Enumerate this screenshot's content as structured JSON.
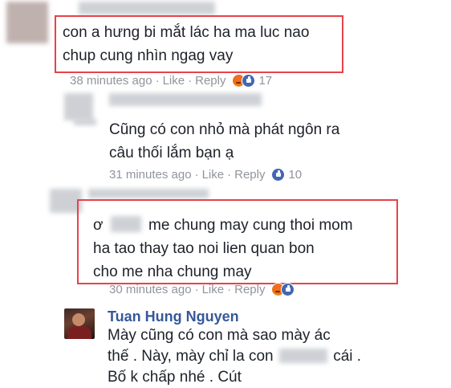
{
  "comments": [
    {
      "lines": [
        "con a hưng bi mắt lác ha ma luc nao",
        "chup cung nhìn ngag vay"
      ],
      "time": "38 minutes ago",
      "like_label": "Like",
      "reply_label": "Reply",
      "reactions": [
        "angry-icon",
        "like-icon"
      ],
      "reaction_count": "17"
    },
    {
      "lines": [
        "Cũng có con nhỏ mà phát ngôn ra",
        "câu thối lắm bạn ạ"
      ],
      "time": "31 minutes ago",
      "like_label": "Like",
      "reply_label": "Reply",
      "reactions": [
        "like-icon"
      ],
      "reaction_count": "10"
    },
    {
      "lines": [
        "ơ",
        "me chung may cung thoi mom",
        "ha tao thay tao noi lien quan bon",
        "cho me nha chung may"
      ],
      "time": "30 minutes ago",
      "like_label": "Like",
      "reply_label": "Reply",
      "reactions": [
        "angry-icon",
        "like-icon"
      ]
    },
    {
      "author": "Tuan Hung Nguyen",
      "lines": [
        "Mày cũng có con mà sao mày ác",
        "thế . Này, mày chỉ la con",
        "cái .",
        "Bố k chấp nhé . Cút"
      ]
    }
  ],
  "separator": "·",
  "colors": {
    "highlight_border": "#e8424a",
    "author_link": "#365899",
    "meta_text": "#90949c",
    "like_blue": "#4267b2"
  }
}
